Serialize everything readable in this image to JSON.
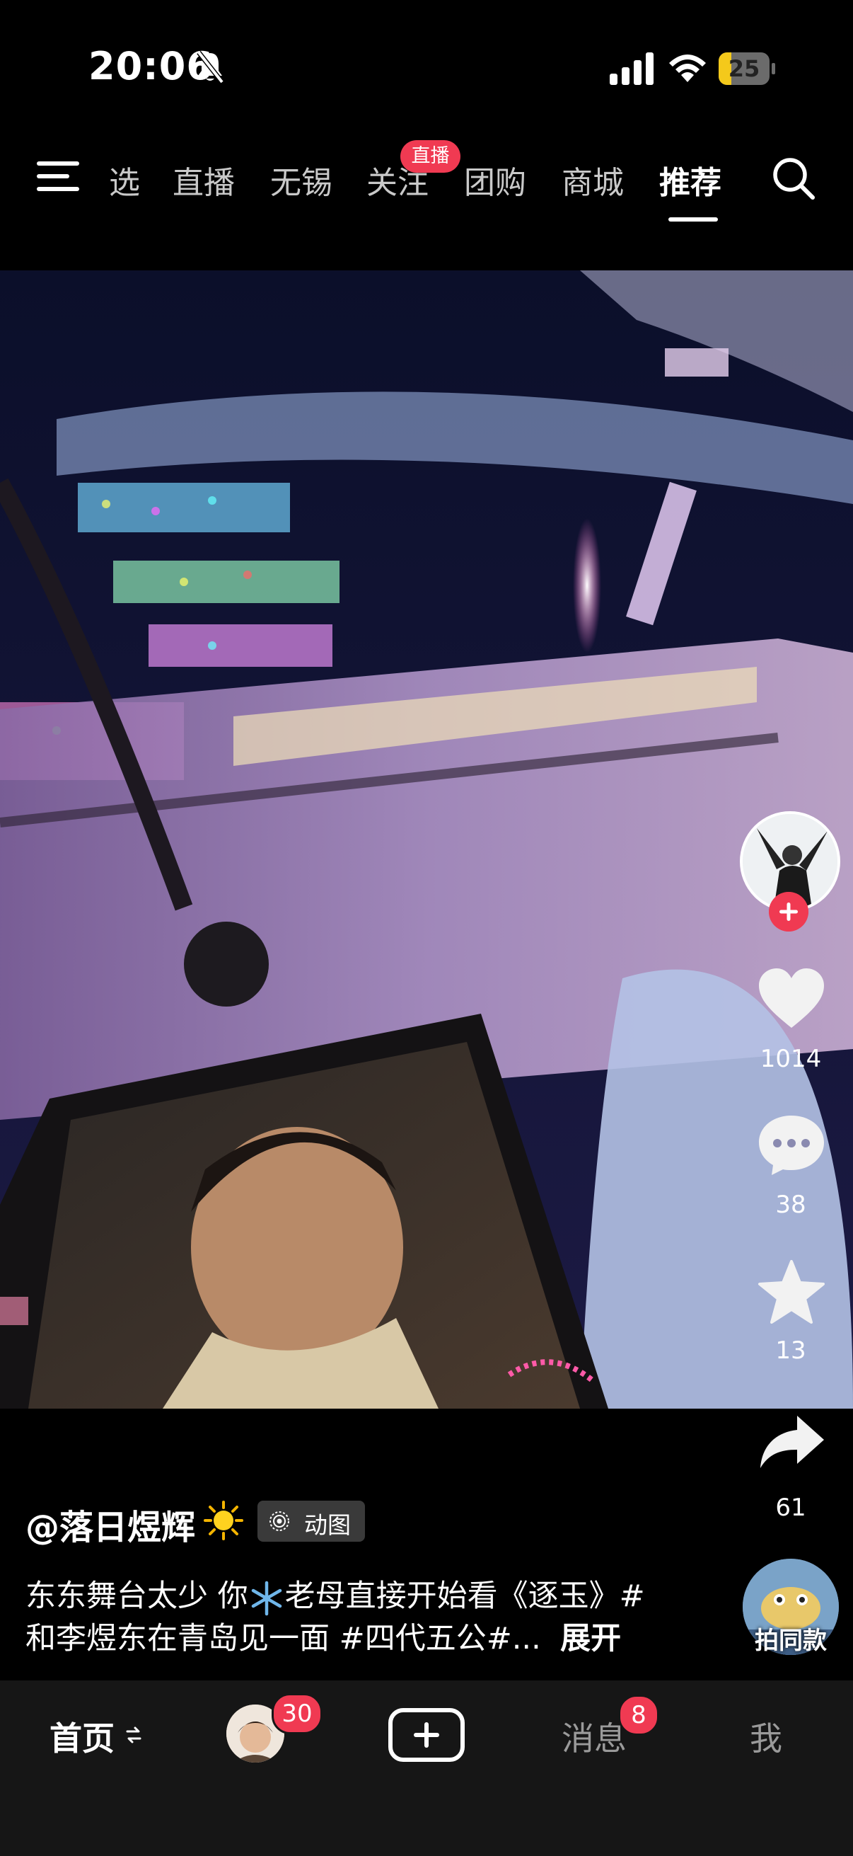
{
  "status_bar": {
    "time": "20:06",
    "battery_level": "25"
  },
  "top_nav": {
    "tabs": [
      {
        "label": "选",
        "active": false
      },
      {
        "label": "直播",
        "active": false
      },
      {
        "label": "无锡",
        "active": false
      },
      {
        "label": "关注",
        "active": false,
        "badge": "直播"
      },
      {
        "label": "团购",
        "active": false
      },
      {
        "label": "商城",
        "active": false
      },
      {
        "label": "推荐",
        "active": true
      }
    ]
  },
  "actions": {
    "likes": "1014",
    "comments": "38",
    "favorites": "13",
    "shares": "61",
    "same_style_label": "拍同款"
  },
  "caption": {
    "author": "@落日煜辉",
    "tag": "动图",
    "line1_part1": "东东舞台太少 你",
    "line1_part2": "老母直接开始看《逐玉》#",
    "line2": "和李煜东在青岛见一面 #四代五公#...",
    "expand": "展开"
  },
  "bottom_bar": {
    "home": "首页",
    "friends_badge": "30",
    "messages": "消息",
    "messages_badge": "8",
    "me": "我"
  },
  "colors": {
    "accent": "#f03a52",
    "battery": "#f4c91b",
    "bottom_bar_bg": "#161616"
  }
}
